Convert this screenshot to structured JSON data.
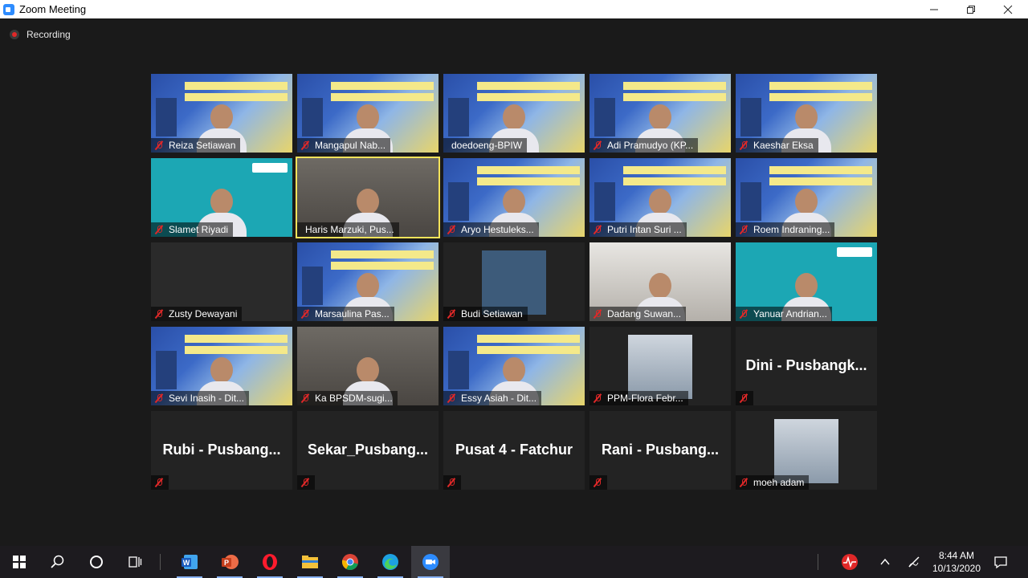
{
  "window": {
    "title": "Zoom Meeting",
    "minimize_icon": "minimize-icon",
    "restore_icon": "restore-icon",
    "close_icon": "close-icon"
  },
  "recording": {
    "label": "Recording",
    "color": "#e02828"
  },
  "active_speaker_color": "#f7e35a",
  "participants": [
    {
      "name": "Reiza Setiawan",
      "video": "banner",
      "muted": true
    },
    {
      "name": "Mangapul Nab...",
      "video": "banner",
      "muted": true
    },
    {
      "name": "doedoeng-BPIW",
      "video": "banner",
      "muted": false
    },
    {
      "name": "Adi Pramudyo (KP...",
      "video": "banner",
      "muted": true
    },
    {
      "name": "Kaeshar Eksa",
      "video": "banner",
      "muted": true
    },
    {
      "name": "Slamet Riyadi",
      "video": "teal",
      "muted": true
    },
    {
      "name": "Haris Marzuki, Pus...",
      "video": "office",
      "muted": false,
      "active": true
    },
    {
      "name": "Aryo Hestuleks...",
      "video": "banner",
      "muted": true
    },
    {
      "name": "Putri Intan Suri ...",
      "video": "banner",
      "muted": true
    },
    {
      "name": "Roem Indraning...",
      "video": "banner",
      "muted": true
    },
    {
      "name": "Zusty Dewayani",
      "video": "dark",
      "muted": true
    },
    {
      "name": "Marsaulina Pas...",
      "video": "banner",
      "muted": true
    },
    {
      "name": "Budi Setiawan",
      "video": "inset",
      "muted": true
    },
    {
      "name": "Dadang Suwan...",
      "video": "room",
      "muted": true
    },
    {
      "name": "Yanuar Andrian...",
      "video": "teal",
      "muted": true
    },
    {
      "name": "Sevi Inasih - Dit...",
      "video": "banner",
      "muted": true
    },
    {
      "name": "Ka BPSDM-sugi...",
      "video": "office",
      "muted": true
    },
    {
      "name": "Essy Asiah - Dit...",
      "video": "banner",
      "muted": true
    },
    {
      "name": "PPM-Flora Febr...",
      "video": "inset-photo",
      "muted": true
    },
    {
      "name": "",
      "display_name": "Dini - Pusbangk...",
      "video": "none",
      "muted": true
    },
    {
      "name": "",
      "display_name": "Rubi - Pusbang...",
      "video": "none",
      "muted": true
    },
    {
      "name": "",
      "display_name": "Sekar_Pusbang...",
      "video": "none",
      "muted": true
    },
    {
      "name": "",
      "display_name": "Pusat 4 - Fatchur",
      "video": "none",
      "muted": true
    },
    {
      "name": "",
      "display_name": "Rani - Pusbang...",
      "video": "none",
      "muted": true
    },
    {
      "name": "moeh adam",
      "video": "inset-photo",
      "muted": true
    }
  ],
  "taskbar": {
    "items": [
      "windows-start-icon",
      "search-icon",
      "cortana-icon",
      "task-view-icon",
      "word-icon",
      "powerpoint-icon",
      "opera-icon",
      "file-explorer-icon",
      "chrome-icon",
      "edge-icon",
      "zoom-icon"
    ],
    "tray": [
      "heartbeat-icon",
      "chevron-up-icon",
      "pen-icon"
    ],
    "time": "8:44 AM",
    "date": "10/13/2020",
    "notification_icon": "notification-icon"
  }
}
